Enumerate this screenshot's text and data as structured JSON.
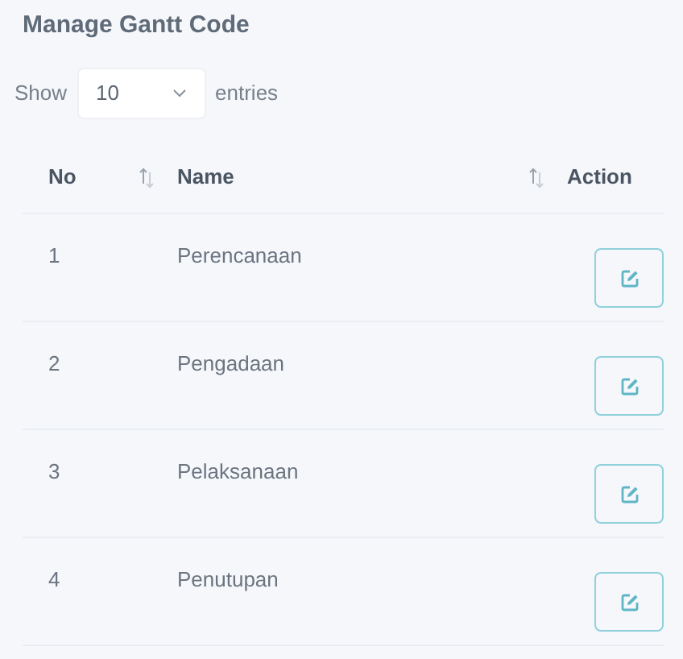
{
  "title": "Manage Gantt Code",
  "length": {
    "label_before": "Show",
    "value": "10",
    "label_after": "entries"
  },
  "table": {
    "columns": [
      {
        "label": "No",
        "sortable": true
      },
      {
        "label": "Name",
        "sortable": true
      },
      {
        "label": "Action",
        "sortable": false
      }
    ],
    "rows": [
      {
        "no": "1",
        "name": "Perencanaan"
      },
      {
        "no": "2",
        "name": "Pengadaan"
      },
      {
        "no": "3",
        "name": "Pelaksanaan"
      },
      {
        "no": "4",
        "name": "Penutupan"
      }
    ]
  }
}
